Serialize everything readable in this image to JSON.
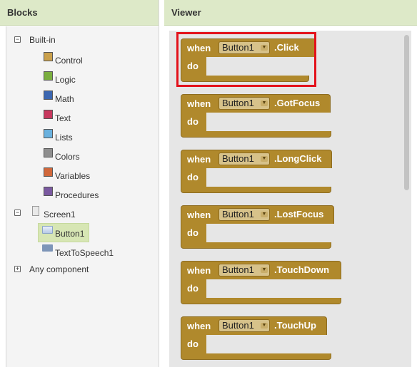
{
  "blocks_panel": {
    "title": "Blocks",
    "builtin_label": "Built-in",
    "builtin_items": [
      {
        "label": "Control",
        "color": "#c9a04c",
        "icon": "control-swatch"
      },
      {
        "label": "Logic",
        "color": "#7aae3f",
        "icon": "logic-swatch"
      },
      {
        "label": "Math",
        "color": "#3b66b0",
        "icon": "math-swatch"
      },
      {
        "label": "Text",
        "color": "#c7385e",
        "icon": "text-swatch"
      },
      {
        "label": "Lists",
        "color": "#6ab1de",
        "icon": "lists-swatch"
      },
      {
        "label": "Colors",
        "color": "#8e8e8e",
        "icon": "colors-swatch"
      },
      {
        "label": "Variables",
        "color": "#d0673a",
        "icon": "variables-swatch"
      },
      {
        "label": "Procedures",
        "color": "#7a59a0",
        "icon": "procedures-swatch"
      }
    ],
    "screen_label": "Screen1",
    "button_label": "Button1",
    "tts_label": "TextToSpeech1",
    "any_component_label": "Any component"
  },
  "viewer": {
    "title": "Viewer",
    "when_kw": "when",
    "do_kw": "do",
    "component": "Button1",
    "events": [
      ".Click",
      ".GotFocus",
      ".LongClick",
      ".LostFocus",
      ".TouchDown",
      ".TouchUp"
    ]
  },
  "colors": {
    "block": "#b0892c",
    "header_bg": "#dde9c8",
    "highlight": "#e3121b"
  }
}
